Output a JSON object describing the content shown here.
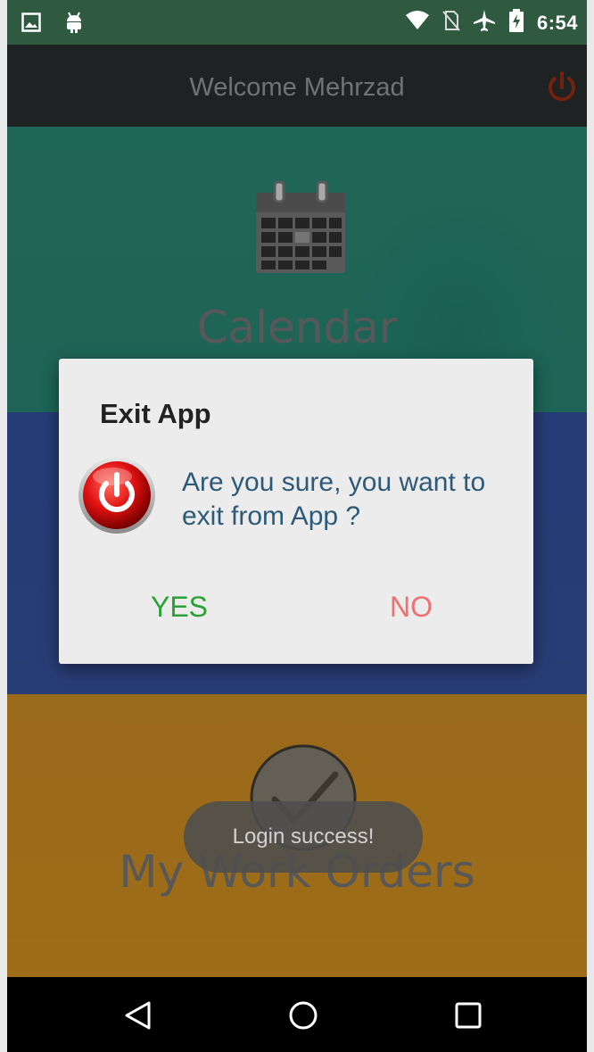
{
  "status_bar": {
    "time": "6:54",
    "left_icons": [
      "image-icon",
      "android-icon"
    ],
    "right_icons": [
      "wifi-icon",
      "no-sim-icon",
      "airplane-icon",
      "battery-charging-icon"
    ]
  },
  "app_bar": {
    "title": "Welcome Mehrzad",
    "power_icon": "power-icon"
  },
  "tiles": {
    "calendar": {
      "label": "Calendar",
      "icon": "calendar-icon",
      "color": "#168470"
    },
    "middle": {
      "color": "#2648a0"
    },
    "work_orders": {
      "label": "My Work Orders",
      "icon": "checkmark-icon",
      "color": "#d08c18"
    }
  },
  "toast": {
    "text": "Login success!"
  },
  "dialog": {
    "title": "Exit App",
    "message": "Are you sure, you want to exit from App ?",
    "icon": "power-button-icon",
    "yes_label": "YES",
    "no_label": "NO",
    "yes_color": "#2aa135",
    "no_color": "#f06f6f"
  },
  "nav_bar": {
    "buttons": [
      "back-icon",
      "home-icon",
      "recents-icon"
    ]
  }
}
